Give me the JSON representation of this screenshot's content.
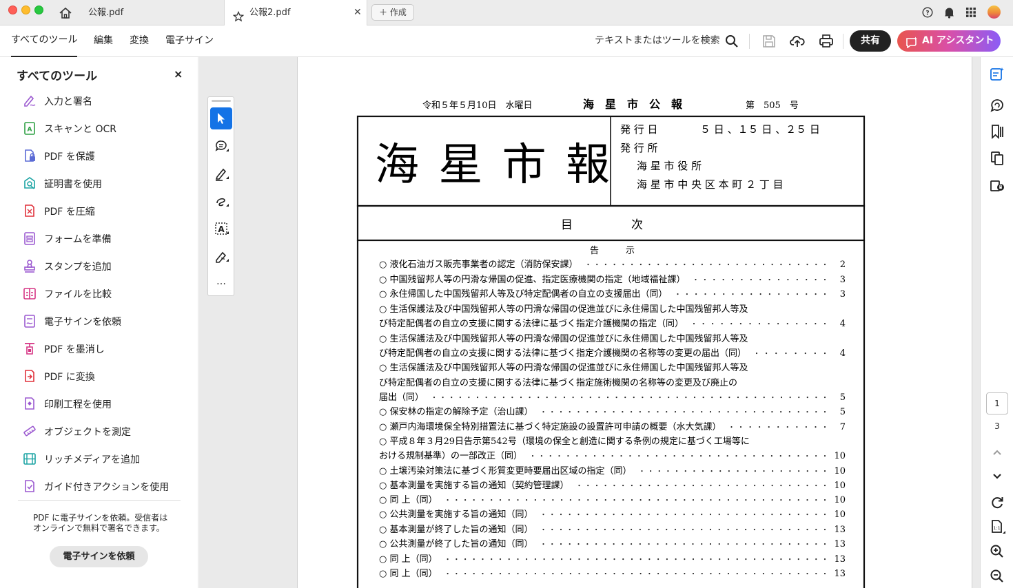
{
  "tabs": [
    {
      "label": "公報.pdf"
    },
    {
      "label": "公報2.pdf"
    }
  ],
  "new_tab_label": "＋ 作成",
  "menu": [
    "すべてのツール",
    "編集",
    "変換",
    "電子サイン"
  ],
  "search_placeholder": "テキストまたはツールを検索",
  "share_label": "共有",
  "ai_label": "AI アシスタント",
  "left_panel": {
    "title": "すべてのツール",
    "close": "×",
    "tools": [
      {
        "label": "入力と署名",
        "icon": "fill-sign-icon",
        "color": "#9b59d0"
      },
      {
        "label": "スキャンと OCR",
        "icon": "scan-ocr-icon",
        "color": "#2ea043"
      },
      {
        "label": "PDF を保護",
        "icon": "protect-pdf-icon",
        "color": "#5b6bd5"
      },
      {
        "label": "証明書を使用",
        "icon": "certificate-icon",
        "color": "#1aa3a3"
      },
      {
        "label": "PDF を圧縮",
        "icon": "compress-pdf-icon",
        "color": "#e0323c"
      },
      {
        "label": "フォームを準備",
        "icon": "prepare-form-icon",
        "color": "#9b59d0"
      },
      {
        "label": "スタンプを追加",
        "icon": "stamp-icon",
        "color": "#9b59d0"
      },
      {
        "label": "ファイルを比較",
        "icon": "compare-files-icon",
        "color": "#d63384"
      },
      {
        "label": "電子サインを依頼",
        "icon": "request-esign-icon",
        "color": "#9b59d0"
      },
      {
        "label": "PDF を墨消し",
        "icon": "redact-icon",
        "color": "#d63384"
      },
      {
        "label": "PDF に変換",
        "icon": "convert-pdf-icon",
        "color": "#e0323c"
      },
      {
        "label": "印刷工程を使用",
        "icon": "print-production-icon",
        "color": "#9b59d0"
      },
      {
        "label": "オブジェクトを測定",
        "icon": "measure-icon",
        "color": "#9b59d0"
      },
      {
        "label": "リッチメディアを追加",
        "icon": "rich-media-icon",
        "color": "#1aa3a3"
      },
      {
        "label": "ガイド付きアクションを使用",
        "icon": "guided-actions-icon",
        "color": "#9b59d0"
      }
    ],
    "promo_line1": "PDF に電子サインを依頼。受信者は",
    "promo_line2": "オンラインで無料で署名できます。",
    "promo_button": "電子サインを依頼"
  },
  "quick_tools_more": "…",
  "document": {
    "header_date": "令和５年５月10日　水曜日",
    "header_title": "海　星　市　公　報",
    "header_issue": "第　505　号",
    "masthead": "海 星 市 報",
    "issue_days_label": "発 行 日",
    "issue_days_value": "５ 日 、１５ 日 、２５ 日",
    "publisher_label": "発 行 所",
    "publisher_name": "海 星 市 役 所",
    "publisher_address": "海 星 市 中 央 区 本 町 ２ 丁 目",
    "contents_title": "目　　　　　次",
    "section_title": "告　　　示",
    "toc": [
      {
        "text": "○ 液化石油ガス販売事業者の認定（消防保安課）",
        "page": "2"
      },
      {
        "text": "○ 中国残留邦人等の円滑な帰国の促進、指定医療機関の指定（地域福祉課）",
        "page": "3"
      },
      {
        "text": "○ 永住帰国した中国残留邦人等及び特定配偶者の自立の支援届出（同）",
        "page": "3"
      },
      {
        "text": "○ 生活保護法及び中国残留邦人等の円滑な帰国の促進並びに永住帰国した中国残留邦人等及",
        "page": ""
      },
      {
        "text": "び特定配偶者の自立の支援に関する法律に基づく指定介護機関の指定（同）",
        "page": "4"
      },
      {
        "text": "○ 生活保護法及び中国残留邦人等の円滑な帰国の促進並びに永住帰国した中国残留邦人等及",
        "page": ""
      },
      {
        "text": "び特定配偶者の自立の支援に関する法律に基づく指定介護機関の名称等の変更の届出（同）",
        "page": "4"
      },
      {
        "text": "○ 生活保護法及び中国残留邦人等の円滑な帰国の促進並びに永住帰国した中国残留邦人等及",
        "page": ""
      },
      {
        "text": "び特定配偶者の自立の支援に関する法律に基づく指定施術機関の名称等の変更及び廃止の",
        "page": ""
      },
      {
        "text": "届出（同）",
        "page": "5"
      },
      {
        "text": "○ 保安林の指定の解除予定（治山課）",
        "page": "5"
      },
      {
        "text": "○ 瀬戸内海環境保全特別措置法に基づく特定施設の設置許可申請の概要（水大気課）",
        "page": "7"
      },
      {
        "text": "○ 平成８年３月29日告示第542号（環境の保全と創造に関する条例の規定に基づく工場等に",
        "page": ""
      },
      {
        "text": "おける規制基準）の一部改正（同）",
        "page": "10"
      },
      {
        "text": "○ 土壌汚染対策法に基づく形質変更時要届出区域の指定（同）",
        "page": "10"
      },
      {
        "text": "○ 基本測量を実施する旨の通知（契約管理課）",
        "page": "10"
      },
      {
        "text": "○ 同 上（同）",
        "page": "10"
      },
      {
        "text": "○ 公共測量を実施する旨の通知（同）",
        "page": "10"
      },
      {
        "text": "○ 基本測量が終了した旨の通知（同）",
        "page": "13"
      },
      {
        "text": "○ 公共測量が終了した旨の通知（同）",
        "page": "13"
      },
      {
        "text": "○ 同 上（同）",
        "page": "13"
      },
      {
        "text": "○ 同 上（同）",
        "page": "13"
      }
    ]
  },
  "page_nav": {
    "current": "1",
    "total": "3"
  },
  "colors": {
    "accent": "#1473e6",
    "share_bg": "#222222",
    "ai_gradient_start": "#e8554e",
    "ai_gradient_end": "#8b5cf6"
  }
}
